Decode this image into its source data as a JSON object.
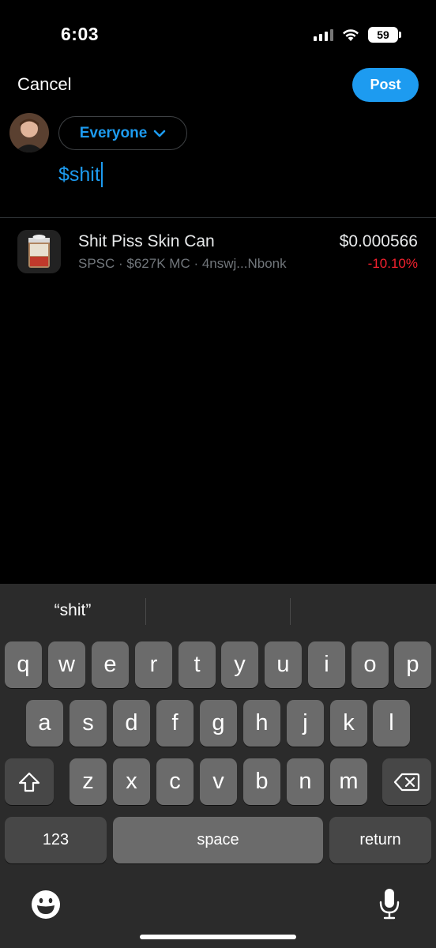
{
  "status_bar": {
    "time": "6:03",
    "battery": "59",
    "icons": [
      "cellular-signal-icon",
      "wifi-icon",
      "battery-icon"
    ]
  },
  "header": {
    "cancel_label": "Cancel",
    "post_label": "Post"
  },
  "composer": {
    "audience_label": "Everyone",
    "text": "$shit"
  },
  "suggestion": {
    "name": "Shit Piss Skin Can",
    "meta": "SPSC · $627K MC · 4nswj...Nbonk",
    "price": "$0.000566",
    "change": "-10.10%",
    "logo_text": "SHIT PISS"
  },
  "keyboard": {
    "predictions": [
      "“shit”",
      "",
      ""
    ],
    "row1": [
      "q",
      "w",
      "e",
      "r",
      "t",
      "y",
      "u",
      "i",
      "o",
      "p"
    ],
    "row2": [
      "a",
      "s",
      "d",
      "f",
      "g",
      "h",
      "j",
      "k",
      "l"
    ],
    "row3": [
      "z",
      "x",
      "c",
      "v",
      "b",
      "n",
      "m"
    ],
    "numbers_label": "123",
    "space_label": "space",
    "return_label": "return"
  },
  "colors": {
    "accent": "#1d9bf0",
    "negative": "#f4212e",
    "background": "#000000",
    "keyboard_bg": "#2b2b2b",
    "key": "#6b6b6b",
    "key_dark": "#474747"
  }
}
